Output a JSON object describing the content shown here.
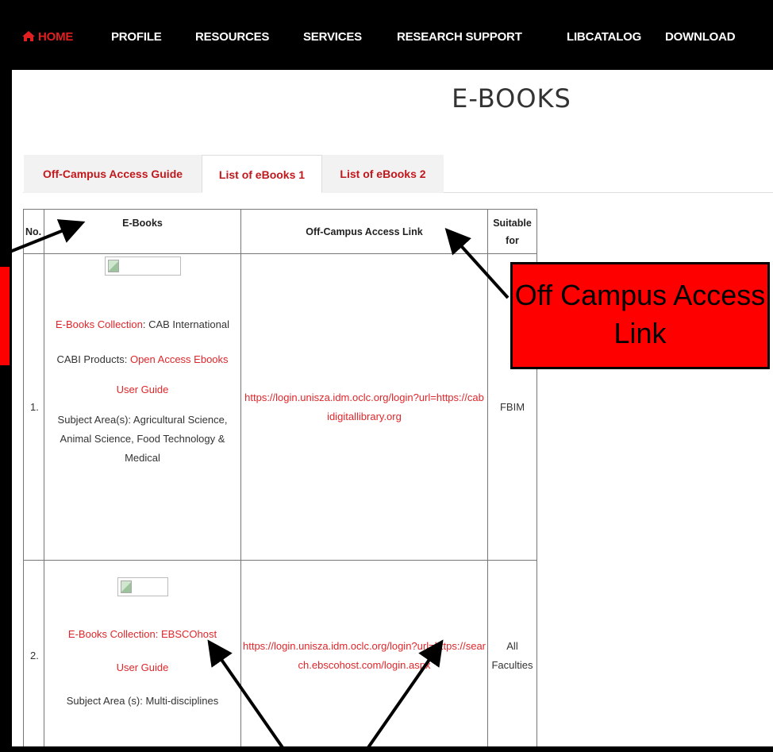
{
  "nav": {
    "items": [
      {
        "label": "HOME",
        "icon": "home-icon",
        "active": true
      },
      {
        "label": "PROFILE"
      },
      {
        "label": "RESOURCES"
      },
      {
        "label": "SERVICES"
      },
      {
        "label": "RESEARCH SUPPORT"
      },
      {
        "label": "LIBCATALOG"
      },
      {
        "label": "DOWNLOAD"
      }
    ]
  },
  "page": {
    "title": "E-BOOKS"
  },
  "tabs": [
    {
      "label": "Off-Campus Access Guide"
    },
    {
      "label": "List of eBooks 1",
      "selected": true
    },
    {
      "label": "List of eBooks 2"
    }
  ],
  "table": {
    "headers": {
      "no": "No.",
      "ebooks": "E-Books",
      "link": "Off-Campus Access Link",
      "suitable": "Suitable for"
    },
    "rows": [
      {
        "no": "1.",
        "collection_label": "E-Books Collection",
        "collection_value": ": CAB International",
        "products_label": "CABI Products: ",
        "products_link": "Open Access Ebooks",
        "guide": "User Guide",
        "subject": "Subject Area(s): Agricultural Science, Animal Science, Food Technology & Medical",
        "link": "https://login.unisza.idm.oclc.org/login?url=https://cabidigitallibrary.org",
        "suitable": "FBIM"
      },
      {
        "no": "2.",
        "collection_link": "E-Books Collection: EBSCOhost",
        "guide": "User Guide",
        "subject": "Subject Area (s): Multi-disciplines",
        "link": "https://login.unisza.idm.oclc.org/login?url=https://search.ebscohost.com/login.aspx",
        "suitable": "All Faculties"
      }
    ]
  },
  "annotation": {
    "callout": "Off Campus Access Link"
  },
  "colors": {
    "accent": "#e0262a",
    "callout_bg": "#ff0000",
    "nav_bg": "#000000"
  }
}
